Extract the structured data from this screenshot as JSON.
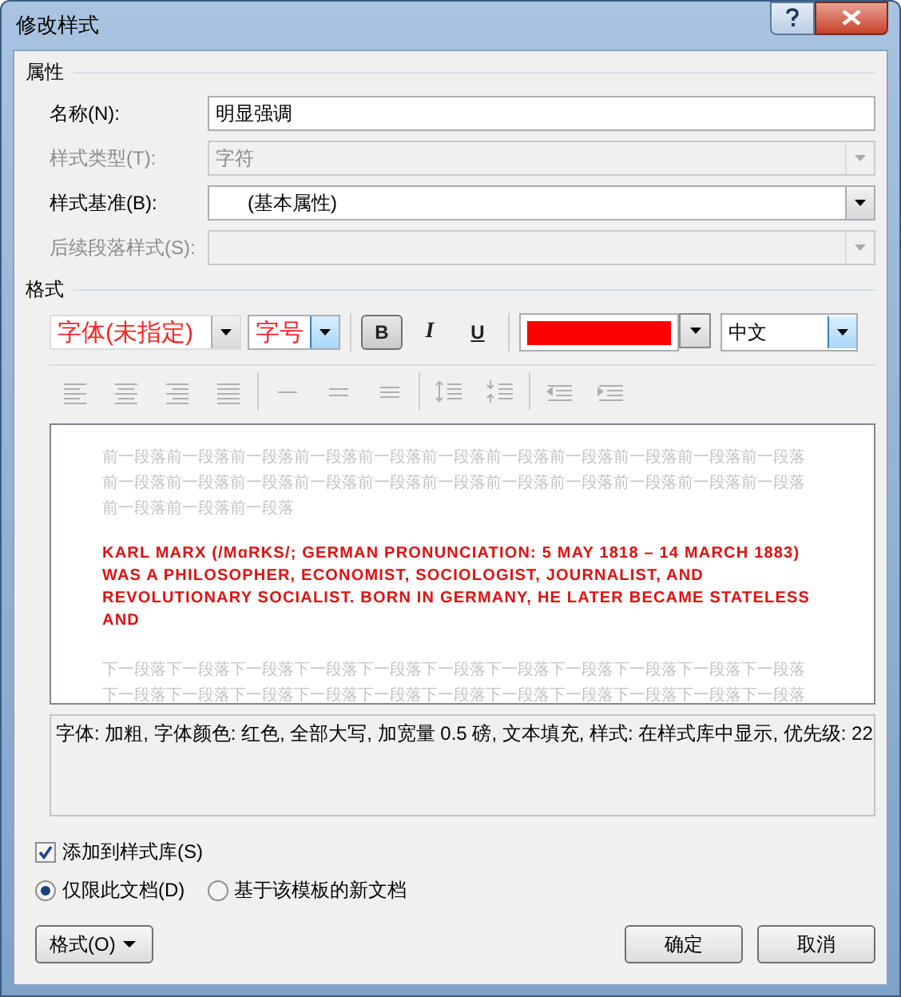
{
  "window": {
    "title": "修改样式"
  },
  "properties": {
    "heading": "属性",
    "fields": [
      {
        "label": "名称(N):",
        "kind": "text",
        "value": "明显强调",
        "disabled": false
      },
      {
        "label": "样式类型(T):",
        "kind": "combo",
        "value": "字符",
        "disabled": true
      },
      {
        "label": "样式基准(B):",
        "kind": "combo",
        "value": "(基本属性)",
        "disabled": false
      },
      {
        "label": "后续段落样式(S):",
        "kind": "combo",
        "disabled": true
      }
    ]
  },
  "format": {
    "heading": "格式",
    "font": "字体(未指定)",
    "size": "字号",
    "styles": [
      {
        "label": "B",
        "selected": true
      },
      {
        "label": "I",
        "selected": false
      },
      {
        "label": "U",
        "selected": false
      }
    ],
    "color": "#ff0000",
    "script": "中文",
    "paragraph_tools_disabled": true
  },
  "preview": {
    "before_lines": [
      "前一段落前一段落前一段落前一段落前一段落前一段落前一段落前一段落前一段落前一段落前一段落",
      "前一段落前一段落前一段落前一段落前一段落前一段落前一段落前一段落前一段落前一段落前一段落",
      "前一段落前一段落前一段落"
    ],
    "sample": "KARL MARX (/MɑRKS/; GERMAN PRONUNCIATION: 5 MAY 1818 – 14 MARCH 1883) WAS A PHILOSOPHER, ECONOMIST, SOCIOLOGIST, JOURNALIST, AND REVOLUTIONARY SOCIALIST. BORN IN GERMANY, HE LATER BECAME STATELESS AND",
    "after_lines": [
      "下一段落下一段落下一段落下一段落下一段落下一段落下一段落下一段落下一段落下一段落下一段落",
      "下一段落下一段落下一段落下一段落下一段落下一段落下一段落下一段落下一段落下一段落下一段落"
    ]
  },
  "description": "字体: 加粗, 字体颜色: 红色, 全部大写, 加宽量  0.5 磅, 文本填充, 样式: 在样式库中显示, 优先级: 22",
  "add_to_gallery": {
    "label": "添加到样式库(S)",
    "checked": true
  },
  "scope": [
    {
      "label": "仅限此文档(D)",
      "selected": true
    },
    {
      "label": "基于该模板的新文档",
      "selected": false
    }
  ],
  "buttons": {
    "format": "格式(O)",
    "ok": "确定",
    "cancel": "取消"
  }
}
